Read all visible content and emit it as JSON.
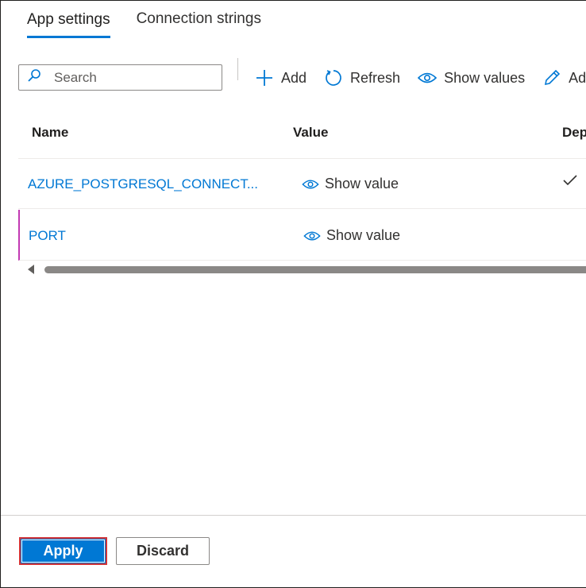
{
  "tabs": [
    {
      "label": "App settings",
      "active": true
    },
    {
      "label": "Connection strings",
      "active": false
    }
  ],
  "search": {
    "placeholder": "Search",
    "value": ""
  },
  "toolbar": {
    "add_label": "Add",
    "refresh_label": "Refresh",
    "show_values_label": "Show values",
    "advanced_edit_label": "Adv"
  },
  "table": {
    "columns": [
      "Name",
      "Value",
      "Dep"
    ],
    "rows": [
      {
        "name": "AZURE_POSTGRESQL_CONNECT...",
        "value_action": "Show value",
        "deployment_slot_setting": true
      },
      {
        "name": "PORT",
        "value_action": "Show value",
        "deployment_slot_setting": false
      }
    ]
  },
  "footer": {
    "apply_label": "Apply",
    "discard_label": "Discard"
  },
  "colors": {
    "accent": "#0078d4",
    "highlight_border": "#d13438",
    "row_selection": "#c239b3"
  }
}
